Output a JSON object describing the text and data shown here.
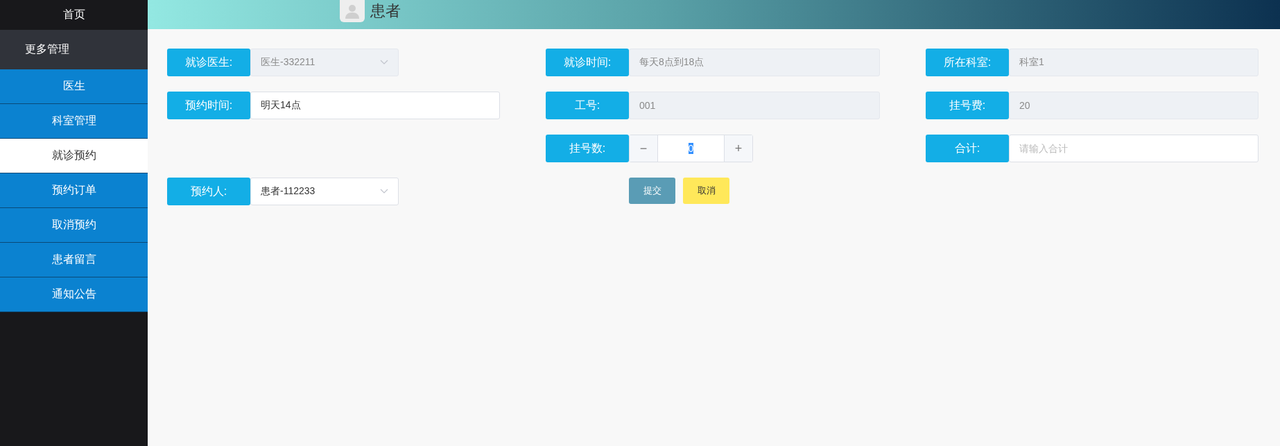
{
  "sidebar": {
    "items": [
      {
        "label": "首页",
        "kind": "home"
      },
      {
        "label": "更多管理",
        "kind": "group"
      },
      {
        "label": "医生",
        "kind": "link",
        "selected": false
      },
      {
        "label": "科室管理",
        "kind": "link",
        "selected": false
      },
      {
        "label": "就诊预约",
        "kind": "link",
        "selected": true
      },
      {
        "label": "预约订单",
        "kind": "link",
        "selected": false
      },
      {
        "label": "取消预约",
        "kind": "link",
        "selected": false
      },
      {
        "label": "患者留言",
        "kind": "link",
        "selected": false
      },
      {
        "label": "通知公告",
        "kind": "link",
        "selected": false
      }
    ]
  },
  "header": {
    "user": "患者"
  },
  "form": {
    "fields": [
      {
        "label": "就诊医生:",
        "kind": "select",
        "value": "医生-332211",
        "disabled": true
      },
      {
        "label": "就诊时间:",
        "kind": "input",
        "value": "每天8点到18点",
        "disabled": true
      },
      {
        "label": "所在科室:",
        "kind": "input",
        "value": "科室1",
        "disabled": true
      },
      {
        "label": "预约时间:",
        "kind": "input",
        "value": "明天14点",
        "disabled": false
      },
      {
        "label": "工号:",
        "kind": "input",
        "value": "001",
        "disabled": true
      },
      {
        "label": "挂号费:",
        "kind": "input",
        "value": "20",
        "disabled": true
      },
      {
        "kind": "empty"
      },
      {
        "label": "挂号数:",
        "kind": "stepper",
        "value": "0",
        "minus": "−",
        "plus": "+"
      },
      {
        "label": "合计:",
        "kind": "input",
        "placeholder": "请输入合计",
        "disabled": false
      },
      {
        "label": "预约人:",
        "kind": "select",
        "value": "患者-112233",
        "disabled": false
      },
      {
        "kind": "actions",
        "buttons": [
          {
            "label": "提交",
            "kind": "submit"
          },
          {
            "label": "取消",
            "kind": "cancel"
          }
        ]
      }
    ]
  }
}
